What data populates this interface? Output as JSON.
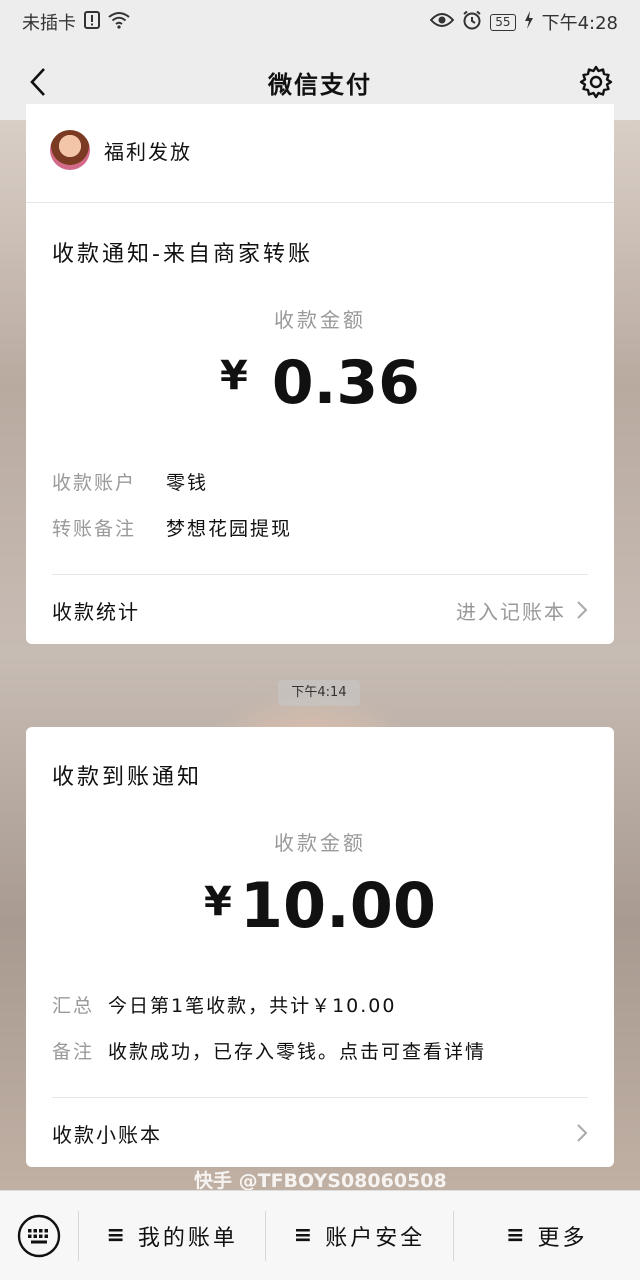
{
  "status_bar": {
    "carrier": "未插卡",
    "battery": "55",
    "time": "下午4:28"
  },
  "header": {
    "title": "微信支付"
  },
  "card1": {
    "sender_name": "福利发放",
    "title": "收款通知-来自商家转账",
    "amount_label": "收款金额",
    "currency": "¥",
    "amount": "0.36",
    "rows": [
      {
        "key": "收款账户",
        "value": "零钱"
      },
      {
        "key": "转账备注",
        "value": "梦想花园提现"
      }
    ],
    "footer_left": "收款统计",
    "footer_right": "进入记账本"
  },
  "timestamp": "下午4:14",
  "card2": {
    "title": "收款到账通知",
    "amount_label": "收款金额",
    "currency": "¥",
    "amount": "10.00",
    "rows": [
      {
        "key": "汇总",
        "value": "今日第1笔收款，共计￥10.00"
      },
      {
        "key": "备注",
        "value": "收款成功，已存入零钱。点击可查看详情"
      }
    ],
    "footer_left": "收款小账本"
  },
  "watermark": "快手 @TFBOYS08060508",
  "bottom_menu": {
    "items": [
      {
        "label": "我的账单"
      },
      {
        "label": "账户安全"
      },
      {
        "label": "更多"
      }
    ]
  }
}
